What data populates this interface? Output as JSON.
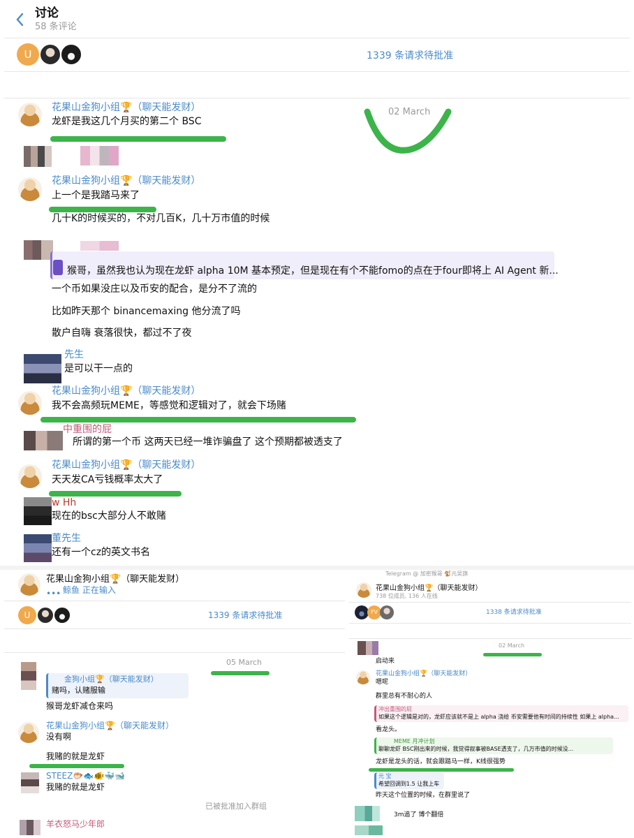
{
  "header": {
    "title": "讨论",
    "subtitle": "58 条评论",
    "requests": "1339 条请求待批准",
    "avatar_letter": "U"
  },
  "main": {
    "date": "02 March",
    "group_sender": "花果山金狗小组🏆（聊天能发财）",
    "m1": "龙虾是我这几个月买的第二个 BSC",
    "m2": "上一个是我踏马来了",
    "m3": "几十K的时候买的，不对几百K，几十万市值的时候",
    "m4_quote": "猴哥，虽然我也认为现在龙虾 alpha 10M 基本预定，但是现在有个不能fomo的点在于four即将上 AI Agent 新...",
    "m5": "一个币如果没庄以及币安的配合，是分不了流的",
    "m6": "比如昨天那个 binancemaxing  他分流了吗",
    "m7": "散户自嗨  衰落很快，都过不了夜",
    "s8": "先生",
    "m8": "是可以干一点的",
    "m9": "我不会高频玩MEME，等感觉和逻辑对了，就会下场赌",
    "s10": "中重围的屁",
    "m10": "所谓的第一个币 这两天已经一堆诈骗盘了  这个预期都被透支了",
    "m11": "天天发CA亏钱概率太大了",
    "s12": "w Hh",
    "m12": "现在的bsc大部分人不敢赌",
    "s13": "董先生",
    "m13": "还有一个cz的英文书名"
  },
  "bottom_left": {
    "title": "花果山金狗小组🏆（聊天能发财）",
    "typing": "鲸鱼 正在输入",
    "requests": "1339 条请求待批准",
    "avatar_letter": "U",
    "date": "05 March",
    "quote_sender": "金狗小组🏆（聊天能发财）",
    "quote_text": "赌吗，认赌服输",
    "m1": "猴哥龙虾减仓来吗",
    "sender": "花果山金狗小组🏆（聊天能发财）",
    "m2": "没有啊",
    "m3": "我赌的就是龙虾",
    "s4": "STEEZ🐡🐟🐠🐳🐋",
    "m4": "我赌的就是龙虾",
    "system": "已被批准加入群组",
    "s5": "羊衣怒马少年郎"
  },
  "bottom_right": {
    "top_text": "Telegram @ 加密猴哥 🐒元吴旗",
    "title": "花果山金狗小组🏆（聊天能发财）",
    "members": "738 位成员, 136 人在线",
    "requests": "1338 条请求待批准",
    "avatar_letter": "FV",
    "date": "02 March",
    "m1": "启动来",
    "sender": "花果山金狗小组🏆（聊天能发财）",
    "m2": "嗯呢",
    "m3": "群里总有不耐心的人",
    "q1_sender": "冲出重围的屁",
    "q1_text": "如果这个逻辑是对的，龙虾应该就不是上 alpha 浇给 币安需要他有时间的持续性  如果上 alpha...",
    "m4": "看龙头。",
    "q2_sender": "MEME 月冲计划",
    "q2_text": "聊聊龙虾  BSC刚出来的时候，我觉得叙事被BASE透支了，几万市值的时候没...",
    "m5": "龙虾是龙头的话，就会跟踏马一样，K线很强势",
    "q3_sender": "元 宝",
    "q3_text": "希望回调到1.5 让我上车",
    "m6": "昨天这个位置的时候，在群里说了",
    "m7": "3m追了 博个翻倍"
  },
  "colors": {
    "accent_blue": "#4a8bc8",
    "highlight_green": "#3cb44a",
    "quote_purple": "#8b6fd6"
  }
}
